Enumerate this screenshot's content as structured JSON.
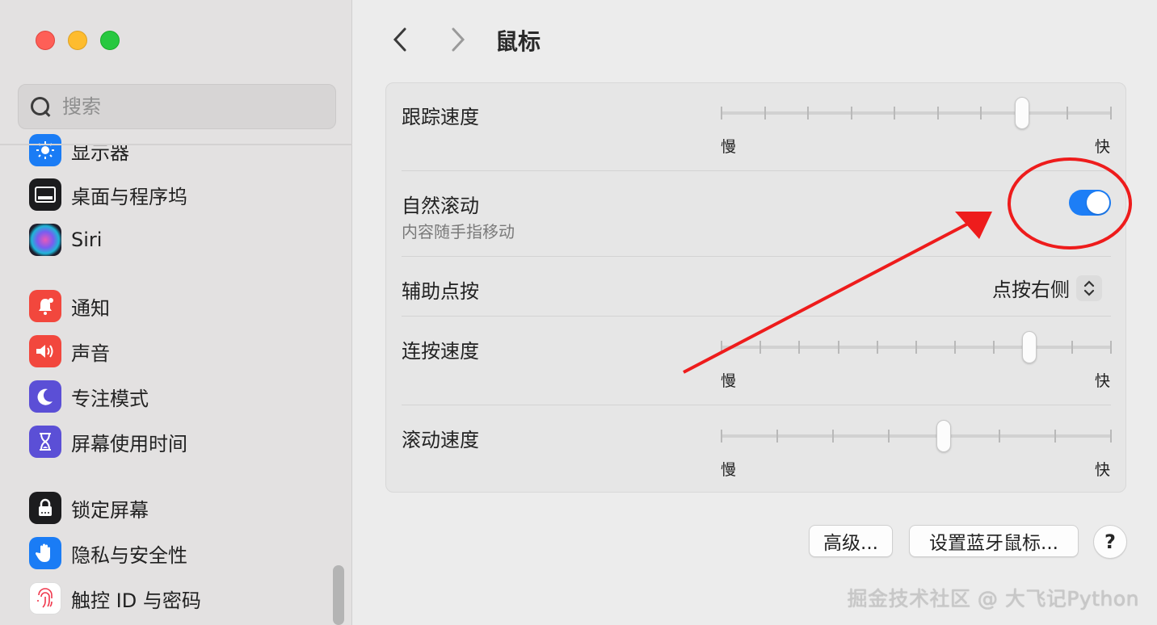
{
  "window": {
    "controls": [
      "close",
      "minimize",
      "zoom"
    ]
  },
  "sidebar": {
    "search_placeholder": "搜索",
    "items": [
      {
        "label": "显示器",
        "icon": "display-icon",
        "color": "#1a7cf5"
      },
      {
        "label": "桌面与程序坞",
        "icon": "desktop-dock-icon",
        "color": "#1c1c1e"
      },
      {
        "label": "Siri",
        "icon": "siri-icon",
        "color": "#2b2b40"
      },
      {
        "label": "通知",
        "icon": "notification-bell-icon",
        "color": "#f2473d"
      },
      {
        "label": "声音",
        "icon": "speaker-icon",
        "color": "#f2473d"
      },
      {
        "label": "专注模式",
        "icon": "moon-icon",
        "color": "#5b4fd6"
      },
      {
        "label": "屏幕使用时间",
        "icon": "hourglass-icon",
        "color": "#5b4fd6"
      },
      {
        "label": "锁定屏幕",
        "icon": "lock-icon",
        "color": "#1c1c1e"
      },
      {
        "label": "隐私与安全性",
        "icon": "hand-icon",
        "color": "#1a7cf5"
      },
      {
        "label": "触控 ID 与密码",
        "icon": "fingerprint-icon",
        "color": "#ffffff"
      }
    ]
  },
  "header": {
    "title": "鼠标",
    "back": "chevron-left-icon",
    "forward": "chevron-right-icon"
  },
  "settings": {
    "tracking": {
      "label": "跟踪速度",
      "min": "慢",
      "max": "快",
      "ticks": 10,
      "value_fraction": 0.77
    },
    "natural_scroll": {
      "label": "自然滚动",
      "sub": "内容随手指移动",
      "enabled": true
    },
    "secondary_click": {
      "label": "辅助点按",
      "value": "点按右侧"
    },
    "double_click": {
      "label": "连按速度",
      "min": "慢",
      "max": "快",
      "ticks": 11,
      "value_fraction": 0.79
    },
    "scroll_speed": {
      "label": "滚动速度",
      "min": "慢",
      "max": "快",
      "ticks": 8,
      "value_fraction": 0.57
    }
  },
  "buttons": {
    "advanced": "高级...",
    "bluetooth": "设置蓝牙鼠标...",
    "help": "?"
  },
  "watermark": "掘金技术社区 @ 大飞记Python",
  "colors": {
    "accent": "#1d7ef6",
    "annotation": "#ee1c1c"
  }
}
